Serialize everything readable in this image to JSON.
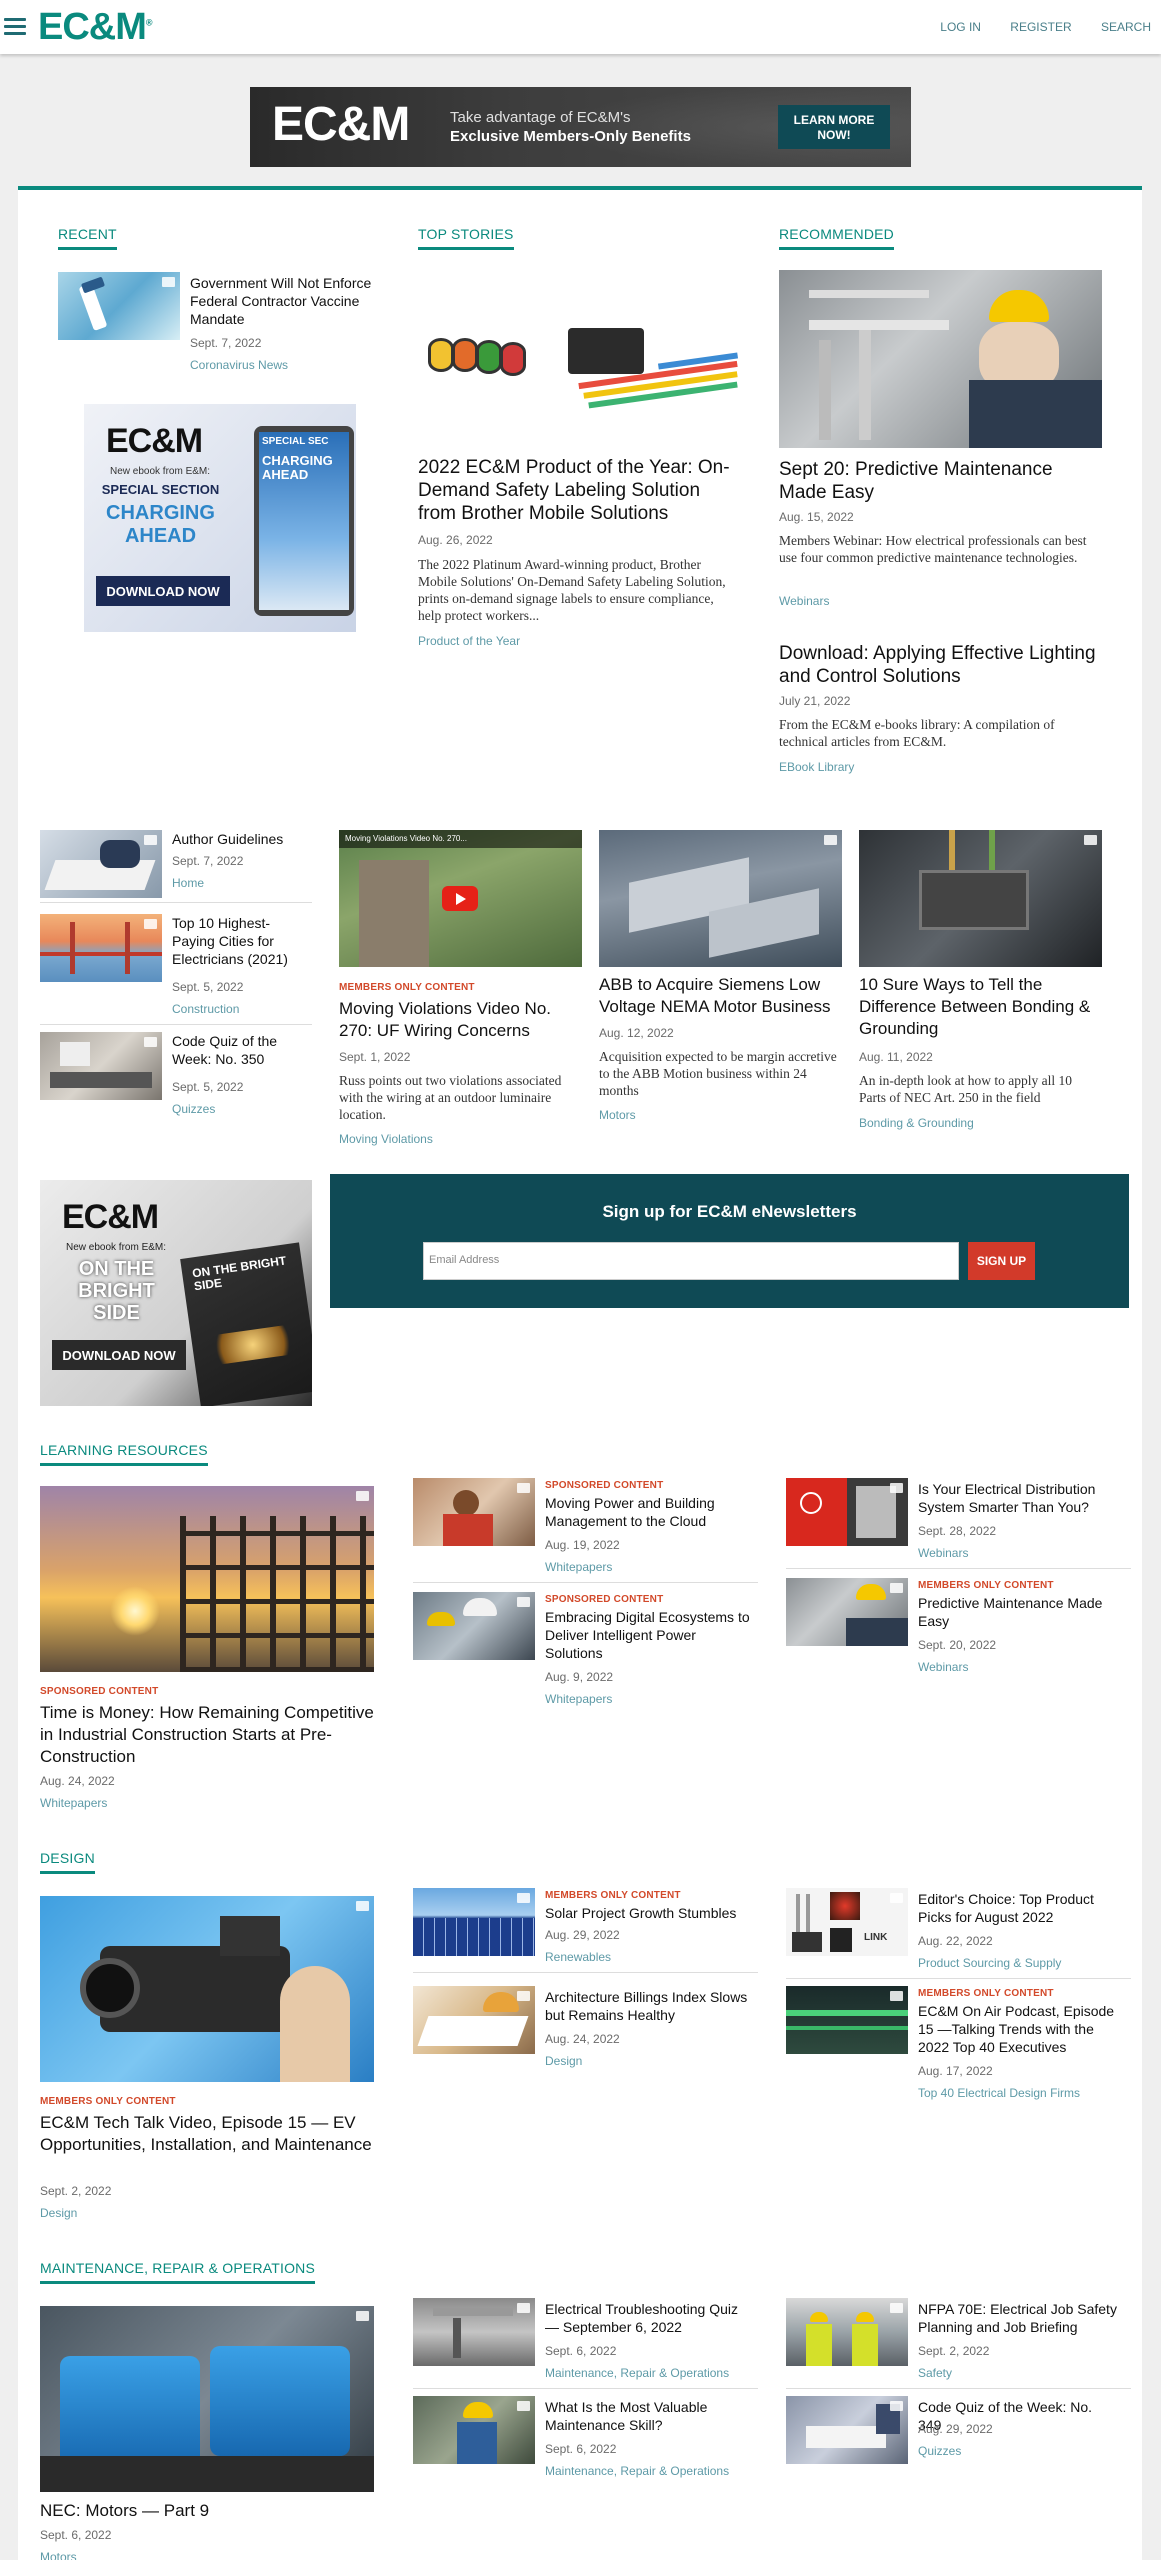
{
  "header": {
    "logo": "EC&M",
    "logo_mark": "®",
    "nav": [
      "LOG IN",
      "REGISTER",
      "SEARCH"
    ]
  },
  "banner_ad": {
    "logo": "EC&M",
    "line1": "Take advantage of EC&M's",
    "line2": "Exclusive Members-Only Benefits",
    "button": "LEARN MORE NOW!"
  },
  "recent": {
    "heading": "RECENT",
    "title": "Government Will Not Enforce Federal Contractor Vaccine Mandate",
    "date": "Sept. 7, 2022",
    "cat": "Coronavirus News"
  },
  "ebook1": {
    "logo": "EC&M",
    "sub": "New ebook from E&M:",
    "special": "SPECIAL SECTION",
    "charging": "CHARGING AHEAD",
    "cover1": "SPECIAL SEC",
    "cover2": "CHARGING AHEAD",
    "button": "DOWNLOAD NOW"
  },
  "top_stories": {
    "heading": "TOP STORIES",
    "title": "2022 EC&M Product of the Year: On-Demand Safety Labeling Solution from Brother Mobile Solutions",
    "date": "Aug. 26, 2022",
    "desc": "The 2022 Platinum Award-winning product, Brother Mobile Solutions' On-Demand Safety Labeling Solution, prints on-demand signage labels to ensure compliance, help protect workers...",
    "cat": "Product of the Year"
  },
  "recommended": {
    "heading": "RECOMMENDED",
    "item1": {
      "title": "Sept 20: Predictive Maintenance Made Easy",
      "date": "Aug. 15, 2022",
      "desc": "Members Webinar: How electrical professionals can best use four common predictive maintenance technologies.",
      "cat": "Webinars"
    },
    "item2": {
      "title": "Download: Applying Effective Lighting and Control Solutions",
      "date": "July 21, 2022",
      "desc": "From the EC&M e-books library: A compilation of technical articles from EC&M.",
      "cat": "EBook Library"
    }
  },
  "row2_small": [
    {
      "title": "Author Guidelines",
      "date": "Sept. 7, 2022",
      "cat": "Home"
    },
    {
      "title": "Top 10 Highest-Paying Cities for Electricians (2021)",
      "date": "Sept. 5, 2022",
      "cat": "Construction"
    },
    {
      "title": "Code Quiz of the Week: No. 350",
      "date": "Sept. 5, 2022",
      "cat": "Quizzes"
    }
  ],
  "row2_cards": [
    {
      "kicker": "MEMBERS ONLY CONTENT",
      "title": "Moving Violations Video No. 270: UF Wiring Concerns",
      "date": "Sept. 1, 2022",
      "desc": "Russ points out two violations associated with the wiring at an outdoor luminaire location.",
      "cat": "Moving Violations",
      "video_caption": "Moving Violations Video No. 270..."
    },
    {
      "title": "ABB to Acquire Siemens Low Voltage NEMA Motor Business",
      "date": "Aug. 12, 2022",
      "desc": "Acquisition expected to be margin accretive to the ABB Motion business within 24 months",
      "cat": "Motors"
    },
    {
      "title": "10 Sure Ways to Tell the Difference Between Bonding & Grounding",
      "date": "Aug. 11, 2022",
      "desc": "An in-depth look at how to apply all 10 Parts of NEC Art. 250 in the field",
      "cat": "Bonding & Grounding"
    }
  ],
  "ebook2": {
    "logo": "EC&M",
    "sub": "New ebook from E&M:",
    "title": "ON THE BRIGHT SIDE",
    "cover": "ON THE BRIGHT SIDE",
    "button": "DOWNLOAD NOW"
  },
  "newsletter": {
    "heading": "Sign up for EC&M eNewsletters",
    "placeholder": "Email Address",
    "button": "SIGN UP"
  },
  "learning": {
    "heading": "LEARNING RESOURCES",
    "main": {
      "kicker": "SPONSORED CONTENT",
      "title": "Time is Money: How Remaining Competitive in Industrial Construction Starts at Pre-Construction",
      "date": "Aug. 24, 2022",
      "cat": "Whitepapers"
    },
    "items": [
      {
        "kicker": "SPONSORED CONTENT",
        "title": "Moving Power and Building Management to the Cloud",
        "date": "Aug. 19, 2022",
        "cat": "Whitepapers"
      },
      {
        "kicker": "SPONSORED CONTENT",
        "title": "Embracing Digital Ecosystems to Deliver Intelligent Power Solutions",
        "date": "Aug. 9, 2022",
        "cat": "Whitepapers"
      },
      {
        "title": "Is Your Electrical Distribution System Smarter Than You?",
        "date": "Sept. 28, 2022",
        "cat": "Webinars"
      },
      {
        "kicker": "MEMBERS ONLY CONTENT",
        "title": "Predictive Maintenance Made Easy",
        "date": "Sept. 20, 2022",
        "cat": "Webinars"
      }
    ]
  },
  "design": {
    "heading": "DESIGN",
    "main": {
      "kicker": "MEMBERS ONLY CONTENT",
      "title": "EC&M Tech Talk Video, Episode 15 — EV Opportunities, Installation, and Maintenance",
      "date": "Sept. 2, 2022",
      "cat": "Design"
    },
    "items": [
      {
        "kicker": "MEMBERS ONLY CONTENT",
        "title": "Solar Project Growth Stumbles",
        "date": "Aug. 29, 2022",
        "cat": "Renewables"
      },
      {
        "title": "Architecture Billings Index Slows but Remains Healthy",
        "date": "Aug. 24, 2022",
        "cat": "Design"
      },
      {
        "title": "Editor's Choice: Top Product Picks for August 2022",
        "date": "Aug. 22, 2022",
        "cat": "Product Sourcing & Supply",
        "logo": "LINK"
      },
      {
        "kicker": "MEMBERS ONLY CONTENT",
        "title": "EC&M On Air Podcast, Episode 15 —Talking Trends with the 2022 Top 40 Executives",
        "date": "Aug. 17, 2022",
        "cat": "Top 40 Electrical Design Firms"
      }
    ]
  },
  "mro": {
    "heading": "MAINTENANCE, REPAIR & OPERATIONS",
    "main": {
      "title": "NEC: Motors — Part 9",
      "date": "Sept. 6, 2022",
      "cat": "Motors"
    },
    "items": [
      {
        "title": "Electrical Troubleshooting Quiz — September 6, 2022",
        "date": "Sept. 6, 2022",
        "cat": "Maintenance, Repair & Operations"
      },
      {
        "title": "What Is the Most Valuable Maintenance Skill?",
        "date": "Sept. 6, 2022",
        "cat": "Maintenance, Repair & Operations"
      },
      {
        "title": "NFPA 70E: Electrical Job Safety Planning and Job Briefing",
        "date": "Sept. 2, 2022",
        "cat": "Safety"
      },
      {
        "title": "Code Quiz of the Week: No. 349",
        "date": "Aug. 29, 2022",
        "cat": "Quizzes"
      }
    ]
  },
  "colors": {
    "brand": "#0a8a7e",
    "dark_teal": "#0f4a55",
    "kicker": "#d2492a",
    "category": "#5e9aa7"
  }
}
